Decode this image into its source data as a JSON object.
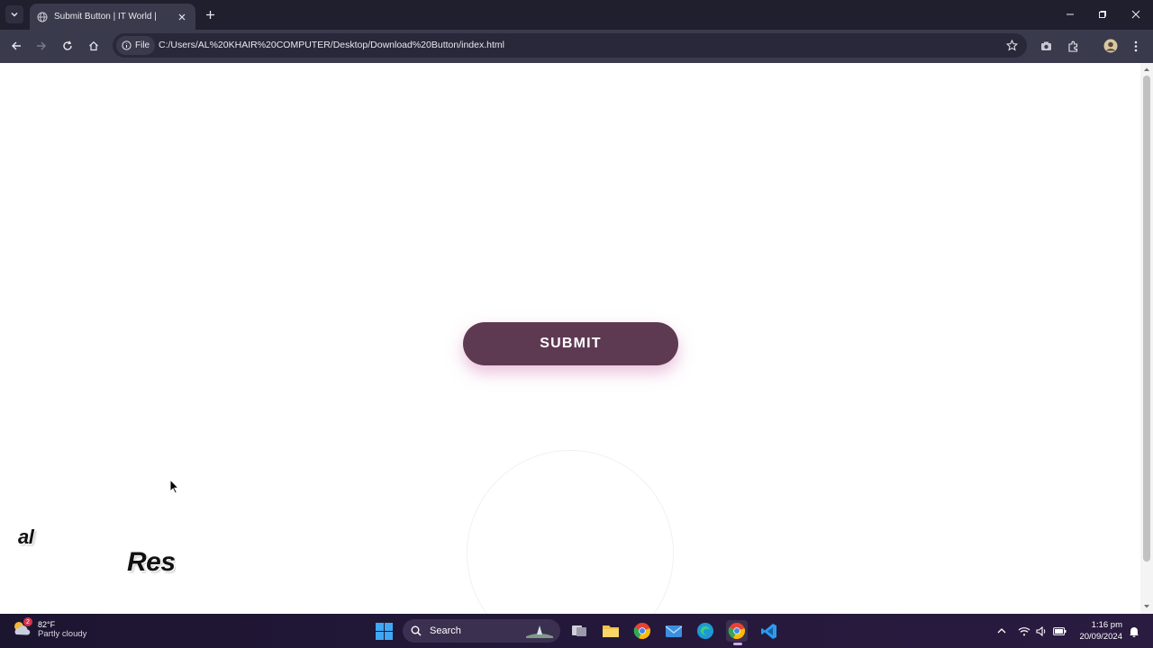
{
  "browser": {
    "tab_title": "Submit Button | IT World |",
    "url_chip": "File",
    "url": "C:/Users/AL%20KHAIR%20COMPUTER/Desktop/Download%20Button/index.html"
  },
  "page": {
    "submit_label": "SUBMIT",
    "text_fragment_1": "al",
    "text_fragment_2": "Res",
    "button_color": "#5e3a52",
    "glow_color": "#d68cbe"
  },
  "taskbar": {
    "weather_badge": "2",
    "weather_temp": "82°F",
    "weather_condition": "Partly cloudy",
    "search_label": "Search",
    "time": "1:16 pm",
    "date": "20/09/2024"
  }
}
